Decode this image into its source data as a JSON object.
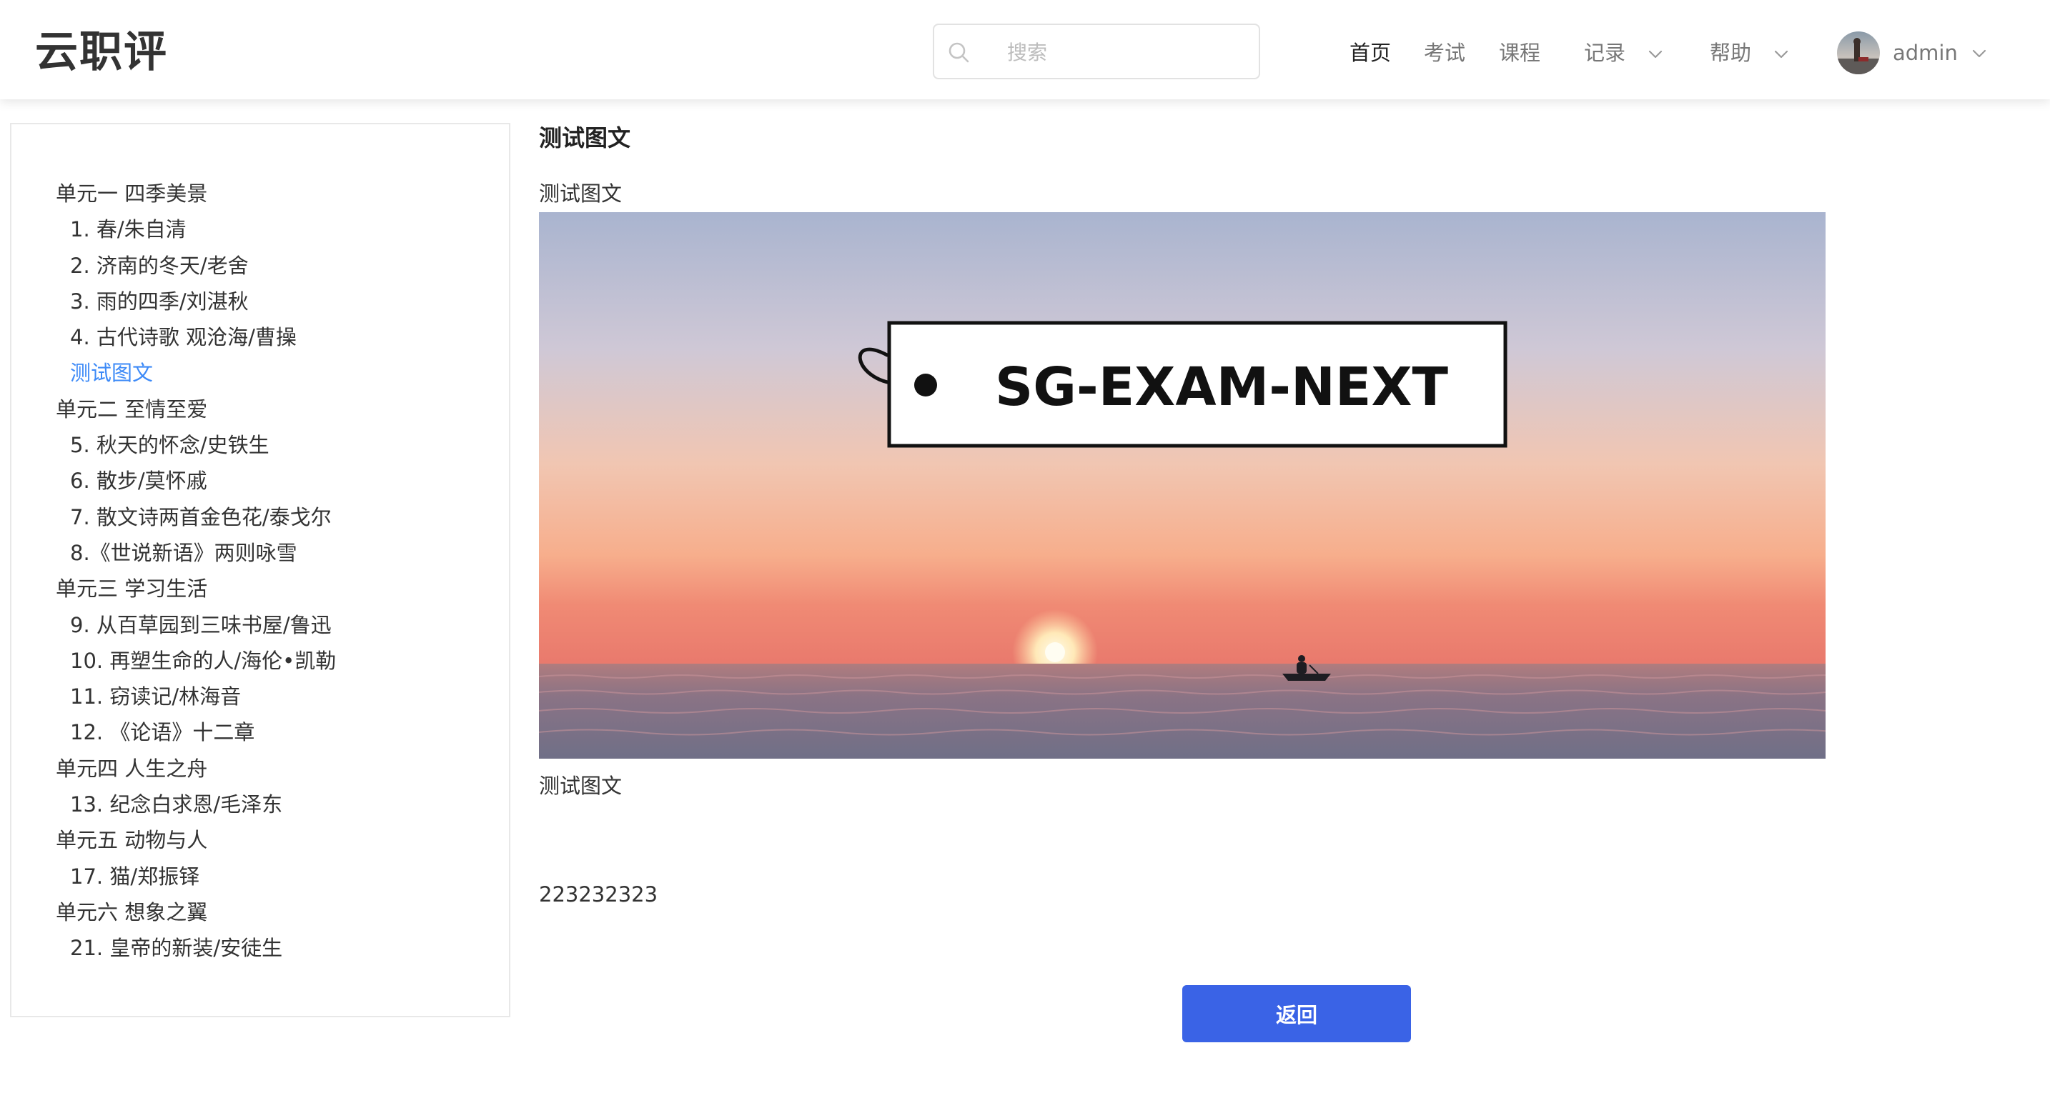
{
  "header": {
    "logo": "云职评",
    "search": {
      "placeholder": "搜索",
      "value": ""
    },
    "nav": [
      {
        "label": "首页",
        "active": true
      },
      {
        "label": "考试"
      },
      {
        "label": "课程"
      },
      {
        "label": "记录",
        "dropdown": true
      },
      {
        "label": "帮助",
        "dropdown": true
      }
    ],
    "user": {
      "name": "admin"
    }
  },
  "sidebar": {
    "items": [
      {
        "type": "chapter",
        "label": "单元一 四季美景"
      },
      {
        "type": "lesson",
        "label": "1.  春/朱自清"
      },
      {
        "type": "lesson",
        "label": "2.  济南的冬天/老舍"
      },
      {
        "type": "lesson",
        "label": "3.  雨的四季/刘湛秋"
      },
      {
        "type": "lesson",
        "label": "4.  古代诗歌 观沧海/曹操"
      },
      {
        "type": "lesson",
        "label": "测试图文",
        "current": true
      },
      {
        "type": "chapter",
        "label": "单元二 至情至爱"
      },
      {
        "type": "lesson",
        "label": "5.  秋天的怀念/史铁生"
      },
      {
        "type": "lesson",
        "label": "6.  散步/莫怀戚"
      },
      {
        "type": "lesson",
        "label": "7.  散文诗两首金色花/泰戈尔"
      },
      {
        "type": "lesson",
        "label": "8.《世说新语》两则咏雪"
      },
      {
        "type": "chapter",
        "label": "单元三 学习生活"
      },
      {
        "type": "lesson",
        "label": "9.  从百草园到三味书屋/鲁迅"
      },
      {
        "type": "lesson",
        "label": "10.  再塑生命的人/海伦•凯勒"
      },
      {
        "type": "lesson",
        "label": "11.  窃读记/林海音"
      },
      {
        "type": "lesson",
        "label": "12.  《论语》十二章"
      },
      {
        "type": "chapter",
        "label": "单元四 人生之舟"
      },
      {
        "type": "lesson",
        "label": "13.  纪念白求恩/毛泽东"
      },
      {
        "type": "chapter",
        "label": "单元五 动物与人"
      },
      {
        "type": "lesson",
        "label": "17.  猫/郑振铎"
      },
      {
        "type": "chapter",
        "label": "单元六 想象之翼"
      },
      {
        "type": "lesson",
        "label": "21.  皇帝的新装/安徒生"
      }
    ]
  },
  "content": {
    "title": "测试图文",
    "paragraph_1": "测试图文",
    "banner_text": "SG-EXAM-NEXT",
    "paragraph_2": "测试图文",
    "paragraph_3": "223232323"
  },
  "actions": {
    "back_label": "返回"
  },
  "colors": {
    "accent": "#3d8af7",
    "button": "#3a63e6",
    "nav_active": "#222222",
    "nav_inactive": "#777777"
  },
  "icons": {
    "search": "search-icon",
    "caret": "chevron-down-icon",
    "avatar": "avatar"
  }
}
